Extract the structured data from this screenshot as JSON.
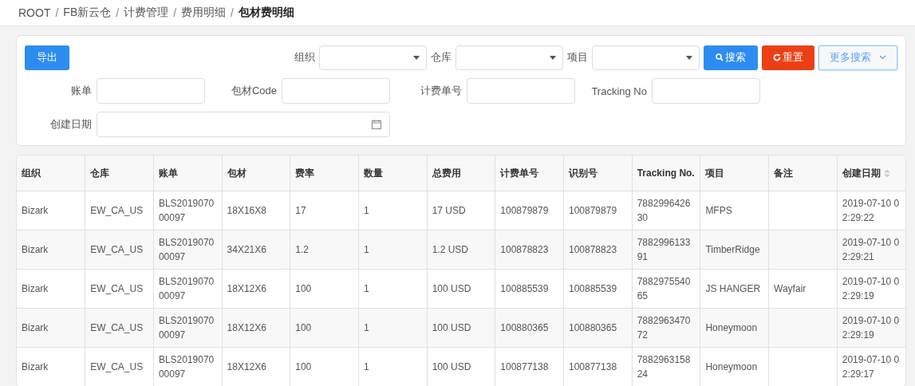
{
  "breadcrumb": [
    {
      "label": "ROOT",
      "current": false
    },
    {
      "separator": "/",
      "label": "FB新云仓",
      "current": false
    },
    {
      "separator": "/",
      "label": "计费管理",
      "current": false
    },
    {
      "separator": "/",
      "label": "费用明细",
      "current": false
    },
    {
      "separator": "/",
      "label": "包材费明细",
      "current": true
    }
  ],
  "toolbar": {
    "export_button": "导出",
    "selects": [
      {
        "label": "组织"
      },
      {
        "label": "仓库"
      },
      {
        "label": "项目"
      }
    ],
    "search_button": "搜索",
    "reset_button": "重置",
    "more_button": "更多搜索"
  },
  "fields": [
    {
      "label": "账单",
      "kind": "text"
    },
    {
      "label": "包材Code",
      "kind": "text"
    },
    {
      "label": "计费单号",
      "kind": "text"
    },
    {
      "label": "Tracking No",
      "kind": "text"
    },
    {
      "label": "创建日期",
      "kind": "date"
    }
  ],
  "table": {
    "columns": [
      {
        "label": "组织",
        "sortable": false
      },
      {
        "label": "仓库",
        "sortable": false
      },
      {
        "label": "账单",
        "sortable": false
      },
      {
        "label": "包材",
        "sortable": false
      },
      {
        "label": "费率",
        "sortable": false
      },
      {
        "label": "数量",
        "sortable": false
      },
      {
        "label": "总费用",
        "sortable": false
      },
      {
        "label": "计费单号",
        "sortable": false
      },
      {
        "label": "识别号",
        "sortable": false
      },
      {
        "label": "Tracking No.",
        "sortable": false
      },
      {
        "label": "项目",
        "sortable": false
      },
      {
        "label": "备注",
        "sortable": false
      },
      {
        "label": "创建日期",
        "sortable": true
      }
    ],
    "rows": [
      [
        "Bizark",
        "EW_CA_US",
        "BLS201907000097",
        "18X16X8",
        "17",
        "1",
        "17 USD",
        "100879879",
        "100879879",
        "788299642630",
        "MFPS",
        null,
        "2019-07-10 02:29:22"
      ],
      [
        "Bizark",
        "EW_CA_US",
        "BLS201907000097",
        "34X21X6",
        "1.2",
        "1",
        "1.2 USD",
        "100878823",
        "100878823",
        "788299613391",
        "TimberRidge",
        null,
        "2019-07-10 02:29:21"
      ],
      [
        "Bizark",
        "EW_CA_US",
        "BLS201907000097",
        "18X12X6",
        "100",
        "1",
        "100 USD",
        "100885539",
        "100885539",
        "788297554065",
        "JS HANGER",
        "Wayfair",
        "2019-07-10 02:29:19"
      ],
      [
        "Bizark",
        "EW_CA_US",
        "BLS201907000097",
        "18X12X6",
        "100",
        "1",
        "100 USD",
        "100880365",
        "100880365",
        "788296347072",
        "Honeymoon",
        null,
        "2019-07-10 02:29:19"
      ],
      [
        "Bizark",
        "EW_CA_US",
        "BLS201907000097",
        "18X12X6",
        "100",
        "1",
        "100 USD",
        "100877138",
        "100877138",
        "788296315824",
        "Honeymoon",
        null,
        "2019-07-10 02:29:17"
      ]
    ]
  }
}
